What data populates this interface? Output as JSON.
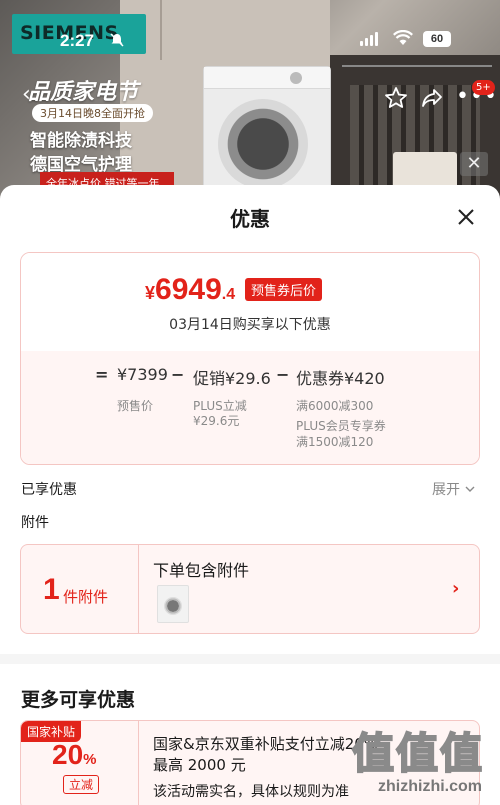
{
  "status_bar": {
    "time": "2:27",
    "battery": "60"
  },
  "background": {
    "brand": "SIEMENS",
    "promo_title": "品质家电节",
    "promo_date": "3月14日晚8全面开抢",
    "promo_line1": "智能除渍科技",
    "promo_line2": "德国空气护理",
    "promo_banner": "全年冰点价 错过等一年",
    "cart_badge": "5+"
  },
  "sheet": {
    "title": "优惠",
    "price": {
      "currency": "¥",
      "integer": "6949",
      "decimal": ".4",
      "tag": "预售券后价",
      "note": "03月14日购买享以下优惠"
    },
    "formula": {
      "equals": "=",
      "base": "¥7399",
      "base_label": "预售价",
      "minus1": "−",
      "promo": "促销¥29.6",
      "promo_detail_1": "PLUS立减",
      "promo_detail_2": "¥29.6元",
      "minus2": "−",
      "coupon": "优惠券¥420",
      "coupon_detail_1": "满6000减300",
      "coupon_detail_2": "PLUS会员专享券",
      "coupon_detail_3": "满1500减120"
    },
    "enjoyed_label": "已享优惠",
    "expand_label": "展开",
    "attachments_label": "附件",
    "attachment_card": {
      "count": "1",
      "unit": "件附件",
      "title": "下单包含附件"
    },
    "more_title": "更多可享优惠",
    "subsidy_card": {
      "tag": "国家补贴",
      "percent": "20",
      "percent_sign": "%",
      "type": "立减",
      "line1": "国家&京东双重补贴支付立减20%",
      "line2": "最高 2000 元",
      "line3": "该活动需实名，具体以规则为准"
    },
    "watermark": {
      "glyphs": "值值值",
      "url": "zhizhizhi.com"
    }
  },
  "colors": {
    "accent": "#e2231a",
    "card_bg": "#fff5f4",
    "card_border": "#f4c6c3"
  }
}
